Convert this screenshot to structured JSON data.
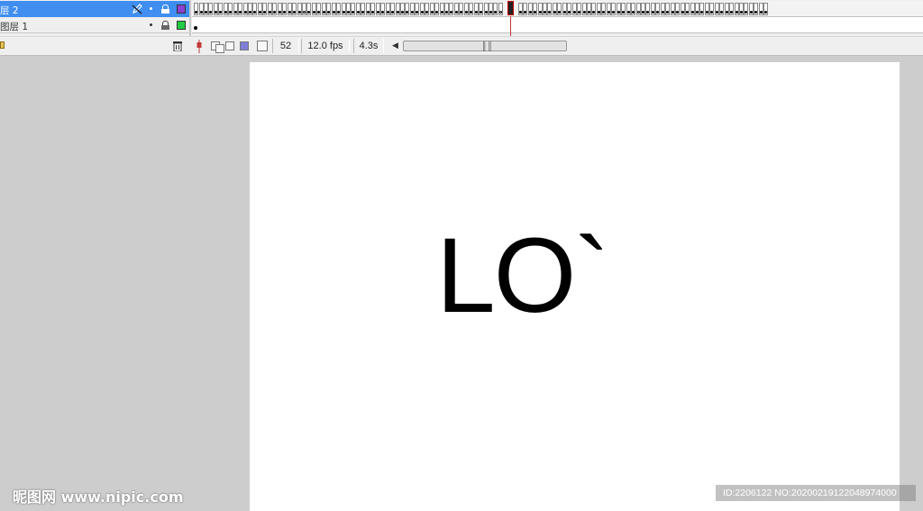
{
  "timeline": {
    "layers": [
      {
        "name": "层 2",
        "selected": true,
        "swatch_color": "#8d3fd0",
        "icon": "pencil-icon"
      },
      {
        "name": "图层 1",
        "selected": false,
        "swatch_color": "#22cc44"
      }
    ],
    "toolbar": {
      "current_frame": "52",
      "frame_rate": "12.0 fps",
      "elapsed_time": "4.3s"
    },
    "playhead_frame": 52
  },
  "stage": {
    "text": "LO`"
  },
  "watermarks": {
    "left": "昵图网 www.nipic.com",
    "right": "ID:2206122 NO:20200219122048974000"
  },
  "colors": {
    "selected_layer": "#3f8ef0",
    "stage_bg": "#ffffff",
    "workspace_bg": "#cdcdcd",
    "playhead": "#c23a3a"
  }
}
